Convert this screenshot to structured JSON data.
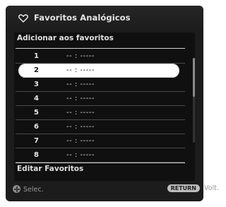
{
  "header": {
    "title": "Favoritos Analógicos",
    "icon": "heart-icon"
  },
  "section_title": "Adicionar aos favoritos",
  "favorites": [
    {
      "num": "1",
      "value": "--   :  -----"
    },
    {
      "num": "2",
      "value": "--   :  -----"
    },
    {
      "num": "3",
      "value": "--   :  -----"
    },
    {
      "num": "4",
      "value": "--   :  -----"
    },
    {
      "num": "5",
      "value": "--   :  -----"
    },
    {
      "num": "6",
      "value": "--   :  -----"
    },
    {
      "num": "7",
      "value": "--   :  -----"
    },
    {
      "num": "8",
      "value": "--   :  -----"
    }
  ],
  "selected_index": 1,
  "edit_label": "Editar Favoritos",
  "footer": {
    "select_label": "Selec.",
    "return_key": "RETURN",
    "return_label": "Volt."
  }
}
